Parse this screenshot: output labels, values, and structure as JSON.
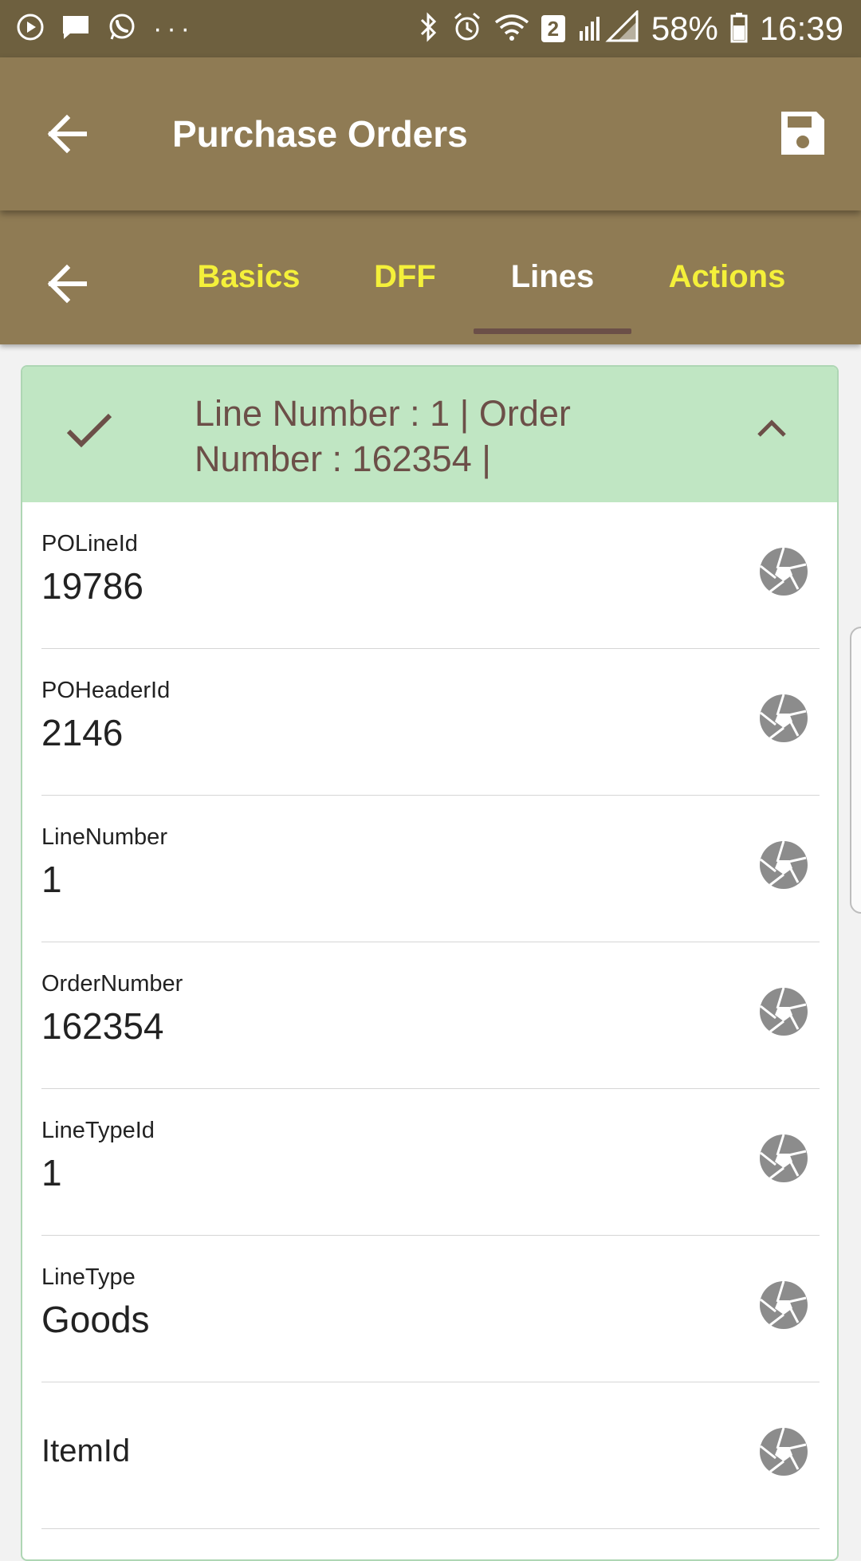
{
  "status_bar": {
    "battery": "58%",
    "time": "16:39",
    "sim_badge": "2",
    "overflow": "···"
  },
  "app_bar": {
    "title": "Purchase Orders"
  },
  "tabs": [
    {
      "label": "Basics",
      "active": false
    },
    {
      "label": "DFF",
      "active": false
    },
    {
      "label": "Lines",
      "active": true
    },
    {
      "label": "Actions",
      "active": false
    }
  ],
  "card": {
    "header_line1": "Line Number : 1 | Order",
    "header_line2": "Number : 162354 |",
    "fields": [
      {
        "label": "POLineId",
        "value": "19786"
      },
      {
        "label": "POHeaderId",
        "value": "2146"
      },
      {
        "label": "LineNumber",
        "value": "1"
      },
      {
        "label": "OrderNumber",
        "value": "162354"
      },
      {
        "label": "LineTypeId",
        "value": "1"
      },
      {
        "label": "LineType",
        "value": "Goods"
      },
      {
        "label": "ItemId",
        "value": ""
      }
    ]
  },
  "colors": {
    "status_bar": "#6e603f",
    "app_bar": "#8f7b54",
    "tab_inactive": "#f4f03a",
    "tab_active": "#ffffff",
    "tab_indicator": "#6b4f48",
    "card_header": "#c0e6c3",
    "card_header_text": "#6c4f48",
    "icon_gray": "#8c8c8c"
  }
}
